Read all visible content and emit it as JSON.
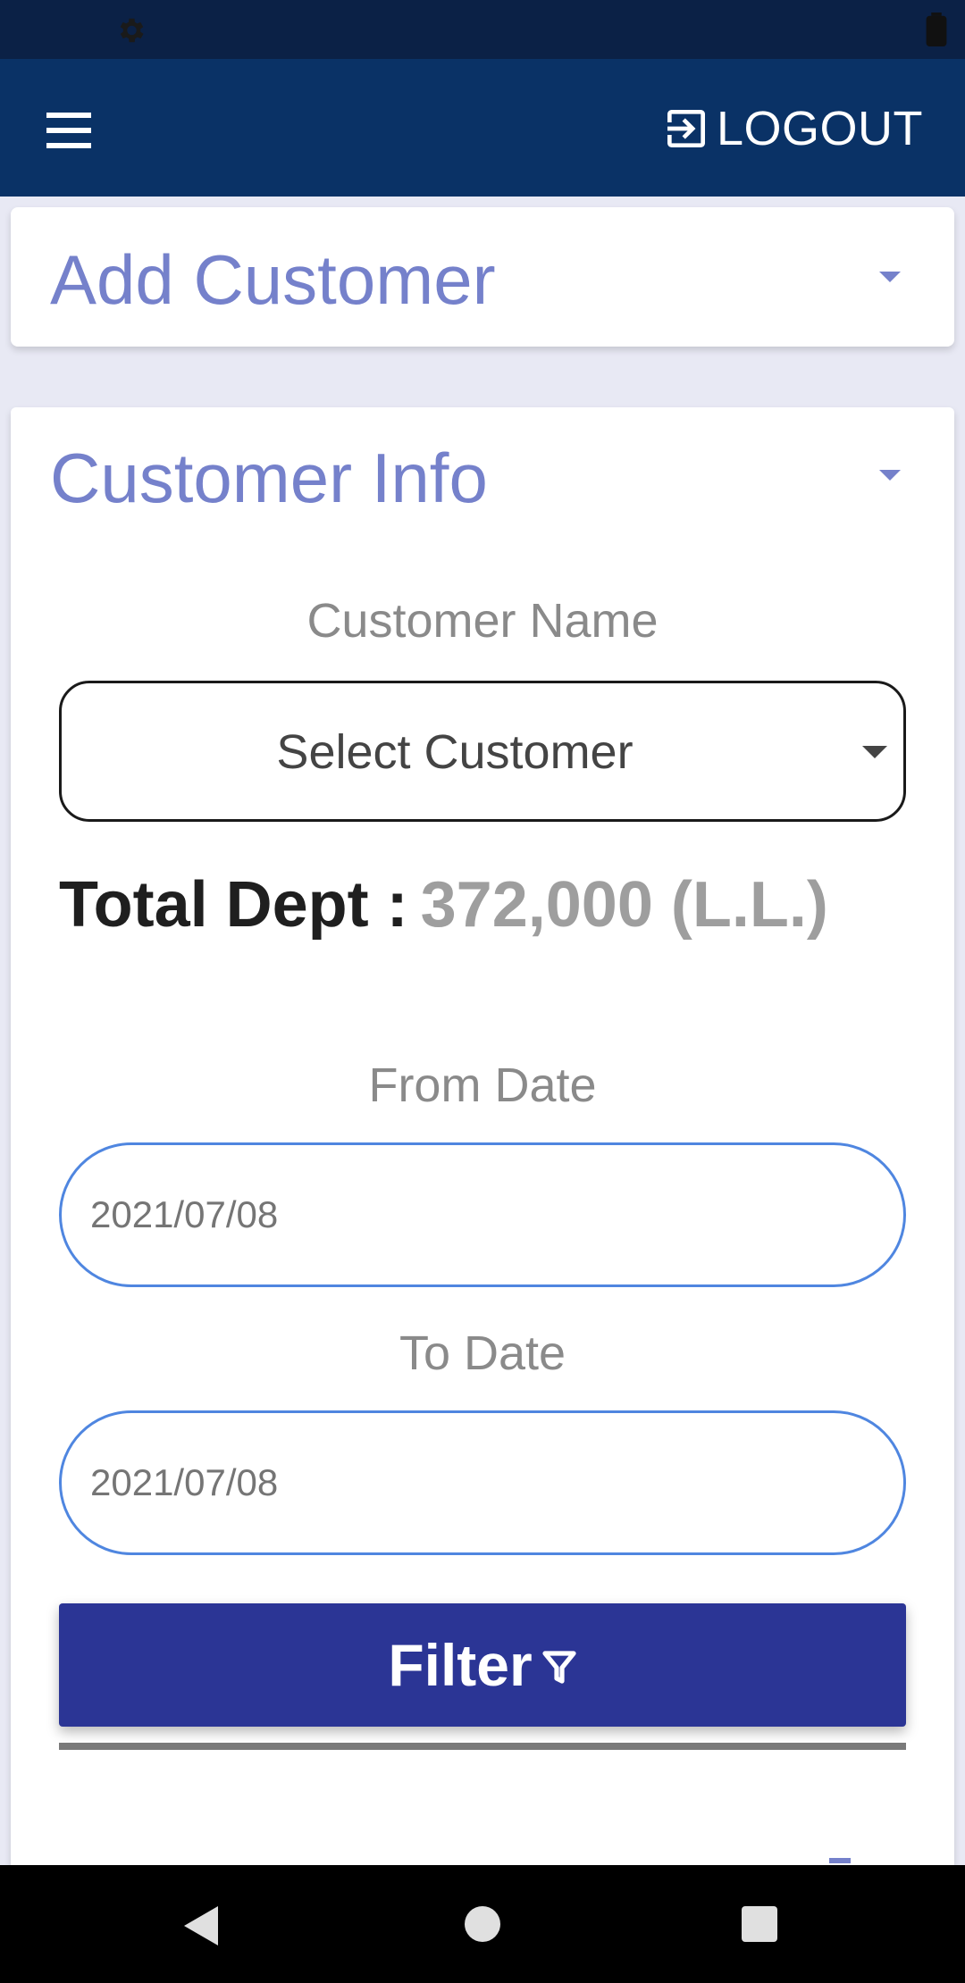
{
  "status_bar": {
    "icons": [
      "gear-icon",
      "battery-icon"
    ]
  },
  "app_bar": {
    "menu_icon": "hamburger-menu-icon",
    "logout_icon": "logout-icon",
    "logout_label": "LOGOUT",
    "background": "#0a3266"
  },
  "add_customer": {
    "title": "Add Customer"
  },
  "customer_info": {
    "title": "Customer Info",
    "customer_name_label": "Customer Name",
    "customer_select_value": "Select Customer",
    "total_dept_label": "Total Dept :",
    "total_dept_value": "372,000 (L.L.)",
    "from_date_label": "From Date",
    "from_date_value": "2021/07/08",
    "to_date_label": "To Date",
    "to_date_value": "2021/07/08",
    "filter_label": "Filter",
    "filter_icon": "filter-funnel-icon"
  },
  "nav_bar": {
    "icons": [
      "back-icon",
      "home-icon",
      "recents-icon"
    ]
  },
  "colors": {
    "accent_title": "#7581cb",
    "filter_button": "#2b3595",
    "date_border": "#4f86e0"
  }
}
